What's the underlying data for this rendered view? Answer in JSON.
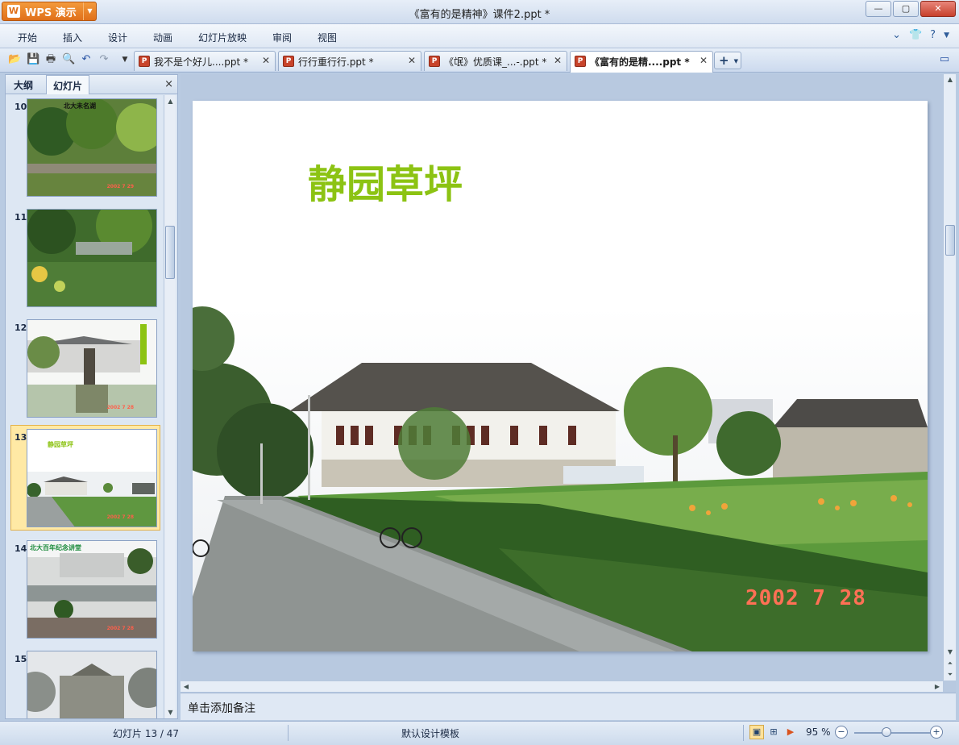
{
  "app": {
    "logo_label": "WPS 演示",
    "window_title": "《富有的是精神》课件2.ppt *"
  },
  "window_controls": {
    "minimize": "—",
    "maximize": "▢",
    "close": "✕"
  },
  "menu": {
    "items": [
      {
        "label": "开始"
      },
      {
        "label": "插入"
      },
      {
        "label": "设计"
      },
      {
        "label": "动画"
      },
      {
        "label": "幻灯片放映"
      },
      {
        "label": "审阅"
      },
      {
        "label": "视图"
      }
    ]
  },
  "tabs": [
    {
      "label": "我不是个好儿....ppt *"
    },
    {
      "label": "行行重行行.ppt *"
    },
    {
      "label": "《氓》优质课_...-.ppt *"
    },
    {
      "label": "《富有的是精....ppt *"
    }
  ],
  "new_tab_label": "+",
  "left_panel": {
    "tabs": [
      {
        "label": "大纲"
      },
      {
        "label": "幻灯片"
      }
    ],
    "close_label": "×",
    "slides": [
      {
        "number": "10",
        "title": "北大未名湖",
        "date": "2002 7 29"
      },
      {
        "number": "11",
        "title": "",
        "date": ""
      },
      {
        "number": "12",
        "title": "",
        "date": "2002 7 28"
      },
      {
        "number": "13",
        "title": "静园草坪",
        "date": "2002 7 28"
      },
      {
        "number": "14",
        "title": "北大百年纪念讲堂",
        "date": "2002 7 28"
      },
      {
        "number": "15",
        "title": "",
        "date": ""
      }
    ]
  },
  "slide": {
    "title": "静园草坪",
    "date_stamp": "2002  7 28"
  },
  "notes_placeholder": "单击添加备注",
  "status": {
    "slide_counter": "幻灯片 13 / 47",
    "template": "默认设计模板",
    "zoom": "95 %"
  },
  "colors": {
    "accent": "#e0701a",
    "title_green": "#8cc313",
    "selection": "#ffe9a5"
  }
}
